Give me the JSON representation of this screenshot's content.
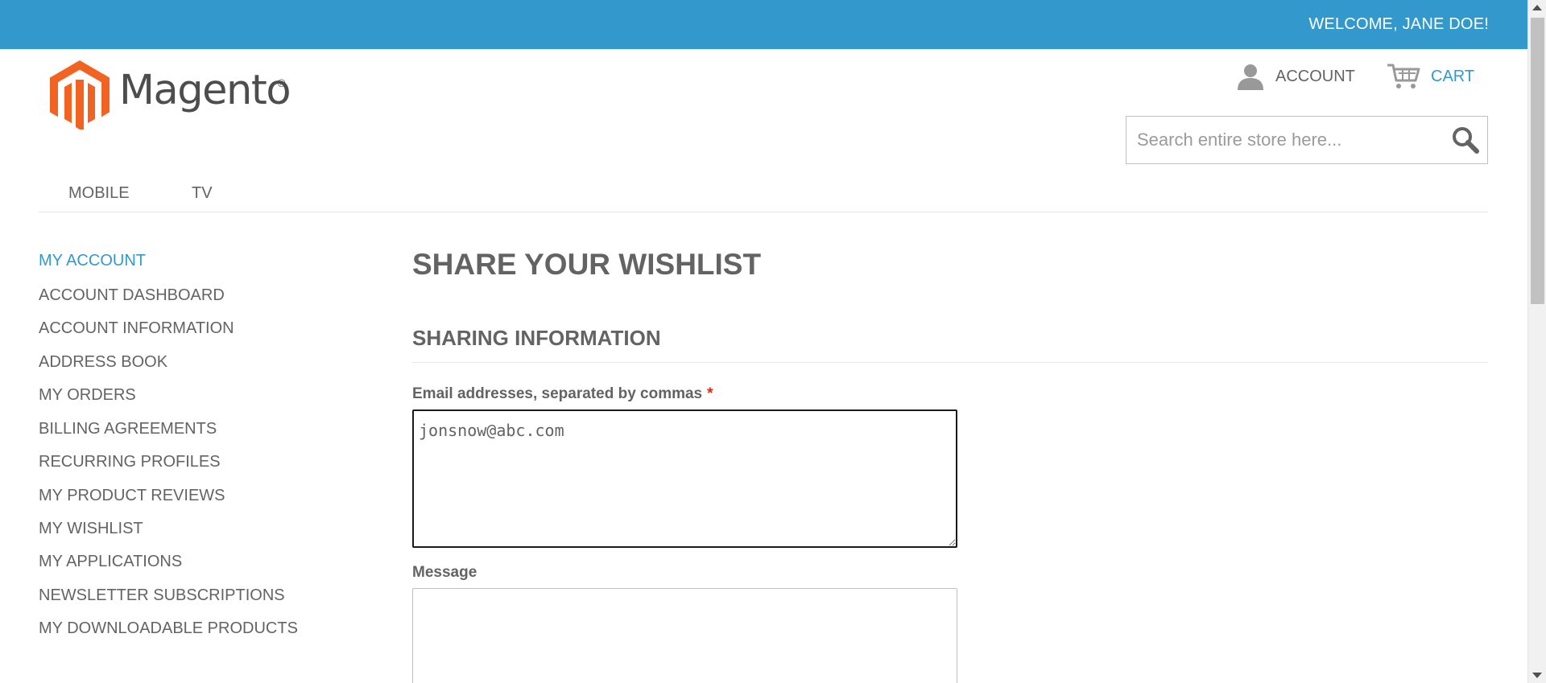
{
  "header": {
    "welcome": "WELCOME, JANE DOE!",
    "logo_text": "Magento",
    "logo_reg": "®",
    "account_label": "ACCOUNT",
    "cart_label": "CART",
    "search_placeholder": "Search entire store here...",
    "search_icon": "search-icon"
  },
  "nav": {
    "items": [
      {
        "label": "MOBILE"
      },
      {
        "label": "TV"
      }
    ]
  },
  "sidebar": {
    "title": "MY ACCOUNT",
    "items": [
      {
        "label": "ACCOUNT DASHBOARD"
      },
      {
        "label": "ACCOUNT INFORMATION"
      },
      {
        "label": "ADDRESS BOOK"
      },
      {
        "label": "MY ORDERS"
      },
      {
        "label": "BILLING AGREEMENTS"
      },
      {
        "label": "RECURRING PROFILES"
      },
      {
        "label": "MY PRODUCT REVIEWS"
      },
      {
        "label": "MY WISHLIST"
      },
      {
        "label": "MY APPLICATIONS"
      },
      {
        "label": "NEWSLETTER SUBSCRIPTIONS"
      },
      {
        "label": "MY DOWNLOADABLE PRODUCTS"
      }
    ]
  },
  "main": {
    "page_title": "SHARE YOUR WISHLIST",
    "section_title": "SHARING INFORMATION",
    "email_label": "Email addresses, separated by commas",
    "required_mark": "*",
    "email_value": "jonsnow@abc.com",
    "message_label": "Message",
    "message_value": ""
  },
  "colors": {
    "accent": "#3399cc",
    "text": "#636363",
    "required": "#df280a",
    "logo_orange": "#f26322"
  }
}
